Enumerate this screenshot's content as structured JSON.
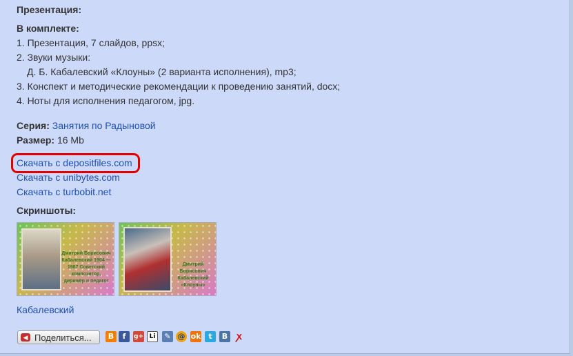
{
  "presentation_heading": "Презентация:",
  "kit": {
    "heading": "В комплекте:",
    "items": [
      "1. Презентация, 7 слайдов, ppsx;",
      "2. Звуки музыки:",
      "Д. Б. Кабалевский «Клоуны» (2 варианта исполнения), mp3;",
      "3. Конспект и методические рекомендации к проведению занятий, docx;",
      "4. Ноты для исполнения педагогом, jpg."
    ]
  },
  "series": {
    "label": "Серия:",
    "value": "Занятия по Радыновой"
  },
  "size": {
    "label": "Размер:",
    "value": "16 Mb"
  },
  "downloads": [
    "Скачать с depositfiles.com",
    "Скачать с unibytes.com",
    "Скачать с turbobit.net"
  ],
  "screenshots": {
    "heading": "Скриншоты:",
    "thumb1_caption": "Дмитрий Борисович Кабалевский 1904 — 1987 Советский композитор, дирижёр и педагог",
    "thumb2_caption": "Дмитрий Борисович Кабалевский «Клоуны»"
  },
  "tag_link": "Кабалевский",
  "share": {
    "button_label": "Поделиться...",
    "icons": [
      "blogger-icon",
      "facebook-icon",
      "google-plus-icon",
      "livejournal-icon",
      "livejournal-pen-icon",
      "mail-ru-icon",
      "odnoklassniki-icon",
      "twitter-icon",
      "vkontakte-icon",
      "yaru-icon"
    ]
  },
  "colors": {
    "background": "#ccd9f8",
    "link": "#1f4fb4",
    "highlight_box": "#e30000"
  }
}
